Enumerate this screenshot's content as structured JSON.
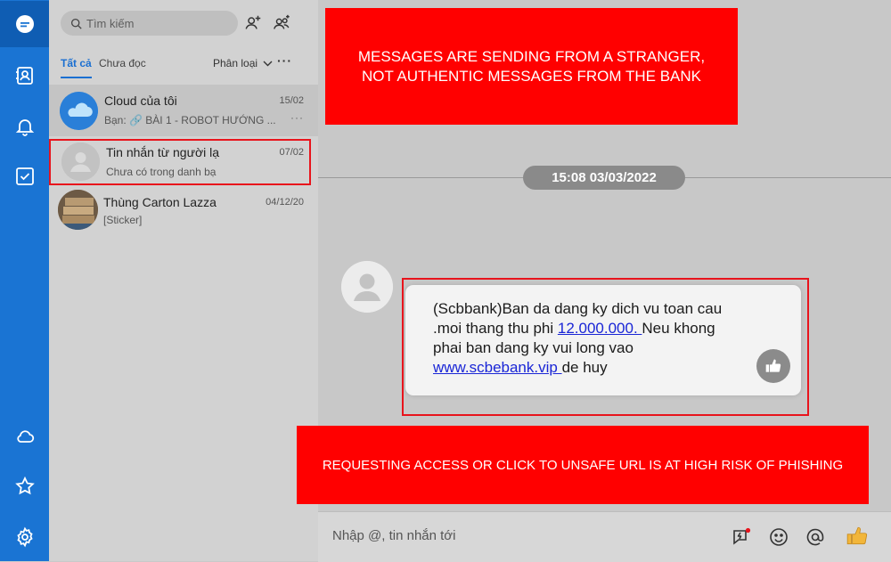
{
  "nav": {
    "items": [
      {
        "name": "chat-bubble-icon",
        "active": true
      },
      {
        "name": "contacts-icon"
      },
      {
        "name": "bell-icon"
      },
      {
        "name": "todo-icon"
      },
      {
        "name": "cloud-icon"
      },
      {
        "name": "star-icon"
      },
      {
        "name": "settings-icon"
      }
    ]
  },
  "sidebar": {
    "search_placeholder": "Tìm kiếm",
    "tabs": [
      "Tất cả",
      "Chưa đọc"
    ],
    "filter_label": "Phân loại",
    "more_label": "···",
    "conversations": [
      {
        "name": "Cloud của tôi",
        "date": "15/02",
        "preview": "Bạn: 🔗 BÀI 1 - ROBOT HƯỚNG ...",
        "dots": "···"
      },
      {
        "name": "Tin nhắn từ người lạ",
        "date": "07/02",
        "preview": "Chưa có trong danh bạ"
      },
      {
        "name": "Thùng Carton Lazza",
        "date": "04/12/20",
        "preview": "[Sticker]"
      }
    ]
  },
  "chat": {
    "date_chip": "15:08 03/03/2022",
    "message": {
      "line1": "(Scbbank)Ban da dang ky dich vu toan cau",
      "line2_pre": ".moi thang thu phi ",
      "line2_link": "12.000.000. ",
      "line2_post": "Neu khong",
      "line3": "phai ban dang ky vui long vao",
      "line4_link": "www.scbebank.vip ",
      "line4_post": "de huy"
    },
    "input_placeholder": "Nhập @, tin nhắn tới"
  },
  "annotations": {
    "top": "MESSAGES ARE SENDING FROM A STRANGER, NOT AUTHENTIC MESSAGES FROM THE BANK",
    "bottom": "REQUESTING ACCESS OR CLICK TO UNSAFE URL IS AT HIGH RISK OF PHISHING"
  },
  "colors": {
    "nav": "#1a74d3",
    "warning_red": "#ff0000",
    "link_blue": "#1a26d6"
  }
}
